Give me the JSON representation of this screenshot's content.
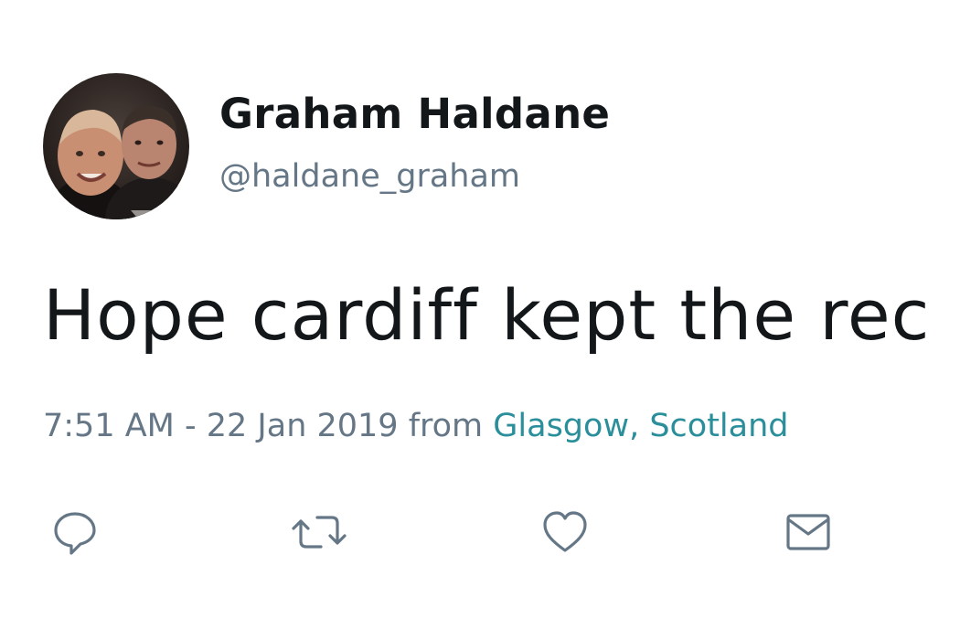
{
  "tweet": {
    "author": {
      "display_name": "Graham Haldane",
      "handle": "@haldane_graham"
    },
    "text": "Hope cardiff kept the rec",
    "meta": {
      "time": "7:51 AM",
      "separator": " - ",
      "date": "22 Jan 2019",
      "from_label": " from ",
      "location": "Glasgow, Scotland"
    },
    "actions": {
      "reply_icon": "speech-bubble",
      "retweet_icon": "retweet-arrows",
      "like_icon": "heart-outline",
      "dm_icon": "envelope"
    }
  },
  "colors": {
    "text": "#14171a",
    "secondary": "#657786",
    "link": "#2a8f9b",
    "background": "#ffffff"
  }
}
